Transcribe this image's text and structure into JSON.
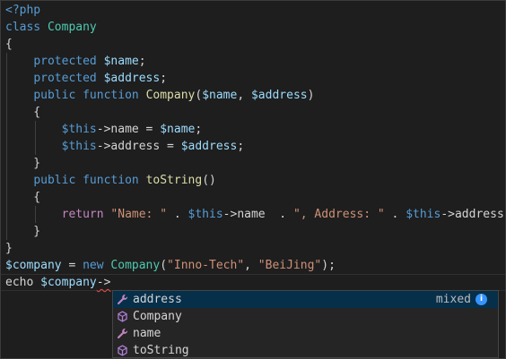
{
  "code": {
    "lines": [
      [
        {
          "t": "<?php",
          "c": "t-php"
        }
      ],
      [
        {
          "t": "class ",
          "c": "t-kw"
        },
        {
          "t": "Company",
          "c": "t-cls"
        }
      ],
      [
        {
          "t": "{",
          "c": "t-plain"
        }
      ],
      [
        {
          "t": "    ",
          "c": "t-plain"
        },
        {
          "t": "protected ",
          "c": "t-kw"
        },
        {
          "t": "$name",
          "c": "t-var"
        },
        {
          "t": ";",
          "c": "t-plain"
        }
      ],
      [
        {
          "t": "    ",
          "c": "t-plain"
        },
        {
          "t": "protected ",
          "c": "t-kw"
        },
        {
          "t": "$address",
          "c": "t-var"
        },
        {
          "t": ";",
          "c": "t-plain"
        }
      ],
      [
        {
          "t": "    ",
          "c": "t-plain"
        },
        {
          "t": "public ",
          "c": "t-kw"
        },
        {
          "t": "function ",
          "c": "t-kw"
        },
        {
          "t": "Company",
          "c": "t-fn"
        },
        {
          "t": "(",
          "c": "t-plain"
        },
        {
          "t": "$name",
          "c": "t-var"
        },
        {
          "t": ", ",
          "c": "t-plain"
        },
        {
          "t": "$address",
          "c": "t-var"
        },
        {
          "t": ")",
          "c": "t-plain"
        }
      ],
      [
        {
          "t": "    {",
          "c": "t-plain"
        }
      ],
      [
        {
          "t": "        ",
          "c": "t-plain"
        },
        {
          "t": "$this",
          "c": "t-kw"
        },
        {
          "t": "->name = ",
          "c": "t-plain"
        },
        {
          "t": "$name",
          "c": "t-var"
        },
        {
          "t": ";",
          "c": "t-plain"
        }
      ],
      [
        {
          "t": "        ",
          "c": "t-plain"
        },
        {
          "t": "$this",
          "c": "t-kw"
        },
        {
          "t": "->address = ",
          "c": "t-plain"
        },
        {
          "t": "$address",
          "c": "t-var"
        },
        {
          "t": ";",
          "c": "t-plain"
        }
      ],
      [
        {
          "t": "    }",
          "c": "t-plain"
        }
      ],
      [
        {
          "t": "    ",
          "c": "t-plain"
        },
        {
          "t": "public ",
          "c": "t-kw"
        },
        {
          "t": "function ",
          "c": "t-kw"
        },
        {
          "t": "toString",
          "c": "t-fn"
        },
        {
          "t": "()",
          "c": "t-plain"
        }
      ],
      [
        {
          "t": "    {",
          "c": "t-plain"
        }
      ],
      [
        {
          "t": "        ",
          "c": "t-plain"
        },
        {
          "t": "return ",
          "c": "t-ret"
        },
        {
          "t": "\"Name: \"",
          "c": "t-str"
        },
        {
          "t": " . ",
          "c": "t-plain"
        },
        {
          "t": "$this",
          "c": "t-kw"
        },
        {
          "t": "->name  . ",
          "c": "t-plain"
        },
        {
          "t": "\", Address: \"",
          "c": "t-str"
        },
        {
          "t": " . ",
          "c": "t-plain"
        },
        {
          "t": "$this",
          "c": "t-kw"
        },
        {
          "t": "->address;",
          "c": "t-plain"
        }
      ],
      [
        {
          "t": "    }",
          "c": "t-plain"
        }
      ],
      [
        {
          "t": "}",
          "c": "t-plain"
        }
      ],
      [
        {
          "t": "$company",
          "c": "t-var"
        },
        {
          "t": " = ",
          "c": "t-plain"
        },
        {
          "t": "new ",
          "c": "t-kw"
        },
        {
          "t": "Company",
          "c": "t-cls"
        },
        {
          "t": "(",
          "c": "t-plain"
        },
        {
          "t": "\"Inno-Tech\"",
          "c": "t-str"
        },
        {
          "t": ", ",
          "c": "t-plain"
        },
        {
          "t": "\"BeiJing\"",
          "c": "t-str"
        },
        {
          "t": ");",
          "c": "t-plain"
        }
      ],
      [
        {
          "t": "echo ",
          "c": "t-plain"
        },
        {
          "t": "$company",
          "c": "t-var"
        },
        {
          "t": "->",
          "c": "t-plain squiggle"
        }
      ]
    ]
  },
  "suggest": {
    "items": [
      {
        "label": "address",
        "icon": "property-wrench-icon",
        "detail": "mixed",
        "selected": true
      },
      {
        "label": "Company",
        "icon": "method-cube-icon",
        "detail": "",
        "selected": false
      },
      {
        "label": "name",
        "icon": "property-wrench-icon",
        "detail": "",
        "selected": false
      },
      {
        "label": "toString",
        "icon": "method-cube-icon",
        "detail": "",
        "selected": false
      }
    ],
    "info_icon": "info-icon",
    "colors": {
      "property": "#c586c0",
      "method": "#b180d7",
      "selected": "#062f4a",
      "info": "#3794ff"
    }
  }
}
